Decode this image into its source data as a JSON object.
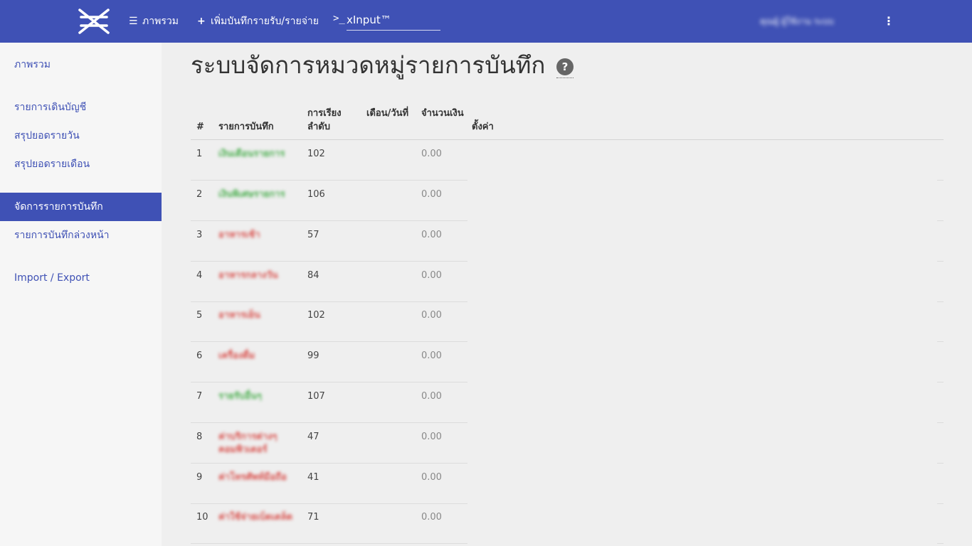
{
  "app": {
    "logo_icon": "brand-x-logo",
    "accent_color": "#3f51b5"
  },
  "topbar": {
    "nav": [
      {
        "icon": "list-icon",
        "label": "ภาพรวม"
      },
      {
        "icon": "plus-icon",
        "label": "เพิ่มบันทึกรายรับ/รายจ่าย"
      }
    ],
    "xinput": {
      "prompt": ">_",
      "value": "xInput™"
    },
    "user_name": "คุณผู้ ผู้ใช้งาน ระบบ",
    "menu_glyph": "⋮"
  },
  "sidebar": {
    "items": [
      {
        "label": "ภาพรวม",
        "active": false
      },
      {
        "label": "รายการเดินบัญชี",
        "active": false
      },
      {
        "label": "สรุปยอดรายวัน",
        "active": false
      },
      {
        "label": "สรุปยอดรายเดือน",
        "active": false
      },
      {
        "label": "จัดการรายการบันทึก",
        "active": true
      },
      {
        "label": "รายการบันทึกล่วงหน้า",
        "active": false
      },
      {
        "label": "Import / Export",
        "active": false
      }
    ]
  },
  "main": {
    "title": "ระบบจัดการหมวดหมู่รายการบันทึก",
    "help_glyph": "?",
    "table": {
      "headers": {
        "num": "#",
        "name": "รายการบันทึก",
        "order": "การเรียงลำดับ",
        "date": "เดือน/วันที่",
        "amount": "จำนวนเงิน",
        "settings": "ตั้งค่า"
      },
      "rows": [
        {
          "num": "1",
          "name": "เงินเดือนรายการ",
          "type": "income",
          "order": "102",
          "date": "",
          "amount": "0.00"
        },
        {
          "num": "2",
          "name": "เงินพิเศษรายการ",
          "type": "income",
          "order": "106",
          "date": "",
          "amount": "0.00"
        },
        {
          "num": "3",
          "name": "อาหารเช้า",
          "type": "expense",
          "order": "57",
          "date": "",
          "amount": "0.00"
        },
        {
          "num": "4",
          "name": "อาหารกลางวัน",
          "type": "expense",
          "order": "84",
          "date": "",
          "amount": "0.00"
        },
        {
          "num": "5",
          "name": "อาหารเย็น",
          "type": "expense",
          "order": "102",
          "date": "",
          "amount": "0.00"
        },
        {
          "num": "6",
          "name": "เครื่องดื่ม",
          "type": "expense",
          "order": "99",
          "date": "",
          "amount": "0.00"
        },
        {
          "num": "7",
          "name": "รายรับอื่นๆ",
          "type": "income",
          "order": "107",
          "date": "",
          "amount": "0.00"
        },
        {
          "num": "8",
          "name": "ค่าบริการต่างๆ คอมพิวเตอร์",
          "type": "expense",
          "order": "47",
          "date": "",
          "amount": "0.00"
        },
        {
          "num": "9",
          "name": "ค่าโทรศัพท์มือถือ",
          "type": "expense",
          "order": "41",
          "date": "",
          "amount": "0.00"
        },
        {
          "num": "10",
          "name": "ค่าใช้จ่ายเบ็ดเตล็ด",
          "type": "expense",
          "order": "71",
          "date": "",
          "amount": "0.00"
        }
      ]
    }
  }
}
